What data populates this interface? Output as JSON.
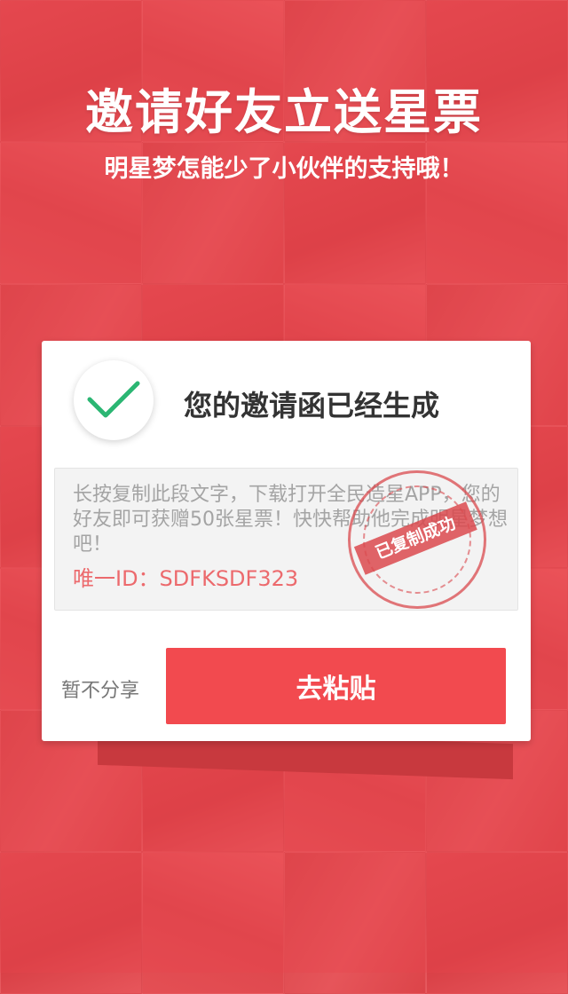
{
  "header": {
    "title": "邀请好友立送星票",
    "subtitle": "明星梦怎能少了小伙伴的支持哦！"
  },
  "card": {
    "status_icon": "checkmark-icon",
    "title": "您的邀请函已经生成",
    "message": "长按复制此段文字，下载打开全民造星APP，您的好友即可获赠50张星票！快快帮助他完成明星梦想吧！",
    "unique_id": "唯一ID：SDFKSDF323",
    "stamp_text": "已复制成功",
    "skip_label": "暂不分享",
    "paste_label": "去粘贴"
  },
  "colors": {
    "brand_red": "#e8474c",
    "button_red": "#f24a4f",
    "check_green": "#2bb673",
    "id_red": "#ec6a6d"
  }
}
